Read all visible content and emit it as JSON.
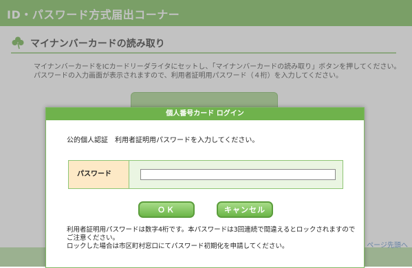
{
  "header": {
    "title": "ID・パスワード方式届出コーナー"
  },
  "section": {
    "icon": "clover-icon",
    "heading": "マイナンバーカードの読み取り",
    "instruction_line1": "マイナンバーカードをICカードリーダライタにセットし、「マイナンバーカードの読み取り」ボタンを押してください。",
    "instruction_line2": "パスワードの入力画面が表示されますので、利用者証明用パスワード（４桁）を入力してください。"
  },
  "background": {
    "link_text": "ページ先頭へ"
  },
  "modal": {
    "title": "個人番号カード ログイン",
    "prompt": "公的個人認証　利用者証明用パスワードを入力してください。",
    "password_label": "パスワード",
    "password_value": "",
    "ok_label": "ＯＫ",
    "cancel_label": "キャンセル",
    "note_line1": "利用者証明用パスワードは数字4桁です。本パスワードは3回連続で間違えるとロックされますので",
    "note_line2": "ご注意ください。",
    "note_line3": "ロックした場合は市区町村窓口にてパスワード初期化を申請してください。"
  },
  "colors": {
    "header_green": "#7dbf5a",
    "modal_title_green": "#6fb24c",
    "label_bg": "#fde9c6"
  }
}
